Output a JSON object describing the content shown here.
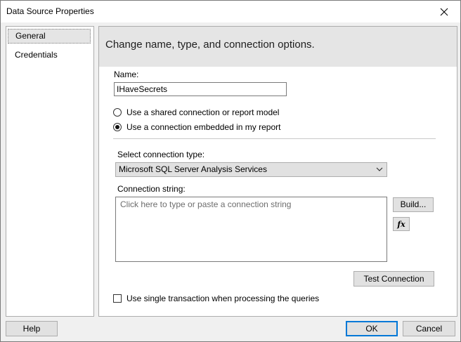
{
  "window": {
    "title": "Data Source Properties",
    "close_icon": "close-icon"
  },
  "nav": {
    "items": [
      {
        "label": "General",
        "selected": true
      },
      {
        "label": "Credentials",
        "selected": false
      }
    ]
  },
  "general": {
    "header": "Change name, type, and connection options.",
    "name_label": "Name:",
    "name_value": "IHaveSecrets",
    "radio_shared": {
      "label": "Use a shared connection or report model",
      "checked": false
    },
    "radio_embedded": {
      "label": "Use a connection embedded in my report",
      "checked": true
    },
    "connection_type_label": "Select connection type:",
    "connection_type_value": "Microsoft SQL Server Analysis Services",
    "connection_string_label": "Connection string:",
    "connection_string_placeholder": "Click here to type or paste a connection string",
    "build_button": "Build...",
    "expression_button": "fx",
    "test_connection_button": "Test Connection",
    "single_transaction": {
      "label": "Use single transaction when processing the queries",
      "checked": false
    }
  },
  "footer": {
    "help_button": "Help",
    "ok_button": "OK",
    "cancel_button": "Cancel"
  },
  "colors": {
    "accent": "#0078d7",
    "header_bg": "#e5e5e5",
    "window_bg": "#f0f0f0"
  }
}
